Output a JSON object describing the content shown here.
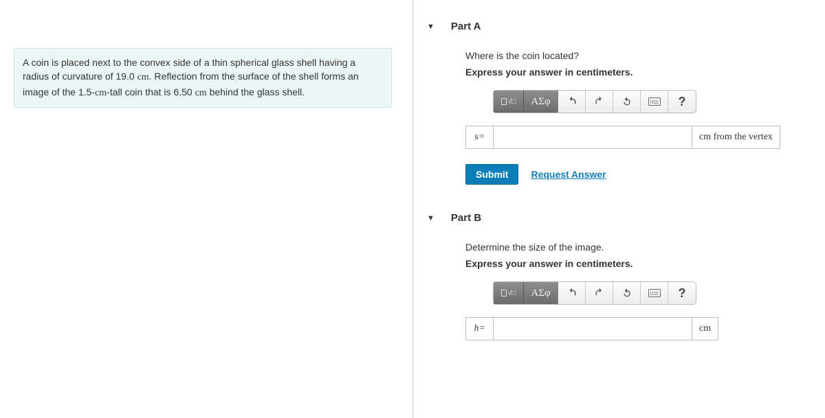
{
  "problem": {
    "text_before": "A coin is placed next to the convex side of a thin spherical glass shell having a radius of curvature of 19.0 ",
    "unit1": "cm",
    "text_mid1": ". Reflection from the surface of the shell forms an image of the 1.5-",
    "unit2": "cm",
    "text_mid2": "-tall coin that is 6.50 ",
    "unit3": "cm",
    "text_end": " behind the glass shell."
  },
  "toolbar": {
    "greek_label": "ΑΣφ",
    "help_label": "?"
  },
  "partA": {
    "title": "Part A",
    "prompt": "Where is the coin located?",
    "instruction": "Express your answer in centimeters.",
    "var_html": "s",
    "eq": " =",
    "value": "",
    "unit": "cm from the vertex",
    "submit": "Submit",
    "request": "Request Answer"
  },
  "partB": {
    "title": "Part B",
    "prompt": "Determine the size of the image.",
    "instruction": "Express your answer in centimeters.",
    "var_html": "h",
    "eq": " =",
    "value": "",
    "unit": "cm"
  }
}
